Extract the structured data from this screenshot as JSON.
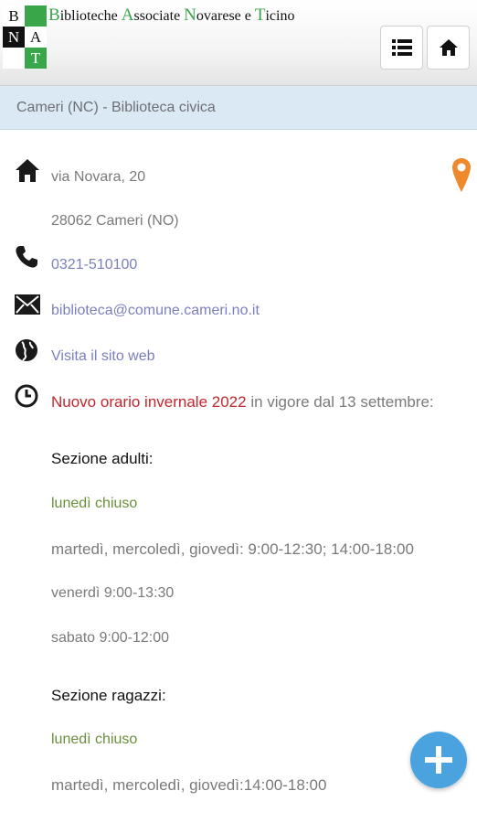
{
  "header": {
    "logo_letters": [
      "B",
      "A",
      "N",
      "T"
    ],
    "title_parts": [
      {
        "cap": "B",
        "rest": "iblioteche "
      },
      {
        "cap": "A",
        "rest": "ssociate "
      },
      {
        "cap": "N",
        "rest": "ovarese e "
      },
      {
        "cap": "T",
        "rest": "icino"
      }
    ],
    "menu_icon": "list-icon",
    "home_icon": "home-icon"
  },
  "title": "Cameri (NC) - Biblioteca civica",
  "contact": {
    "address_line1": "via Novara, 20",
    "address_line2": "28062 Cameri (NO)",
    "phone": "0321-510100",
    "email": "biblioteca@comune.cameri.no.it",
    "website": "Visita il sito web"
  },
  "hours": {
    "notice": "Nuovo orario invernale 2022",
    "notice_rest": " in vigore dal 13 settembre:",
    "adults_heading": "Sezione adulti:",
    "adults": [
      "lunedì chiuso",
      "martedì, mercoledì, giovedì: 9:00-12:30; 14:00-18:00",
      "venerdì 9:00-13:30",
      "sabato 9:00-12:00"
    ],
    "kids_heading": "Sezione ragazzi:",
    "kids": [
      "lunedì chiuso",
      "martedì, mercoledì, giovedì:14:00-18:00"
    ]
  },
  "colors": {
    "accent_green": "#3aa64a",
    "title_bar": "#dbe9f5",
    "link": "#7b7fbf",
    "notice_red": "#c1272d",
    "map_pin": "#ef8a2c",
    "fab": "#4aa3df"
  }
}
